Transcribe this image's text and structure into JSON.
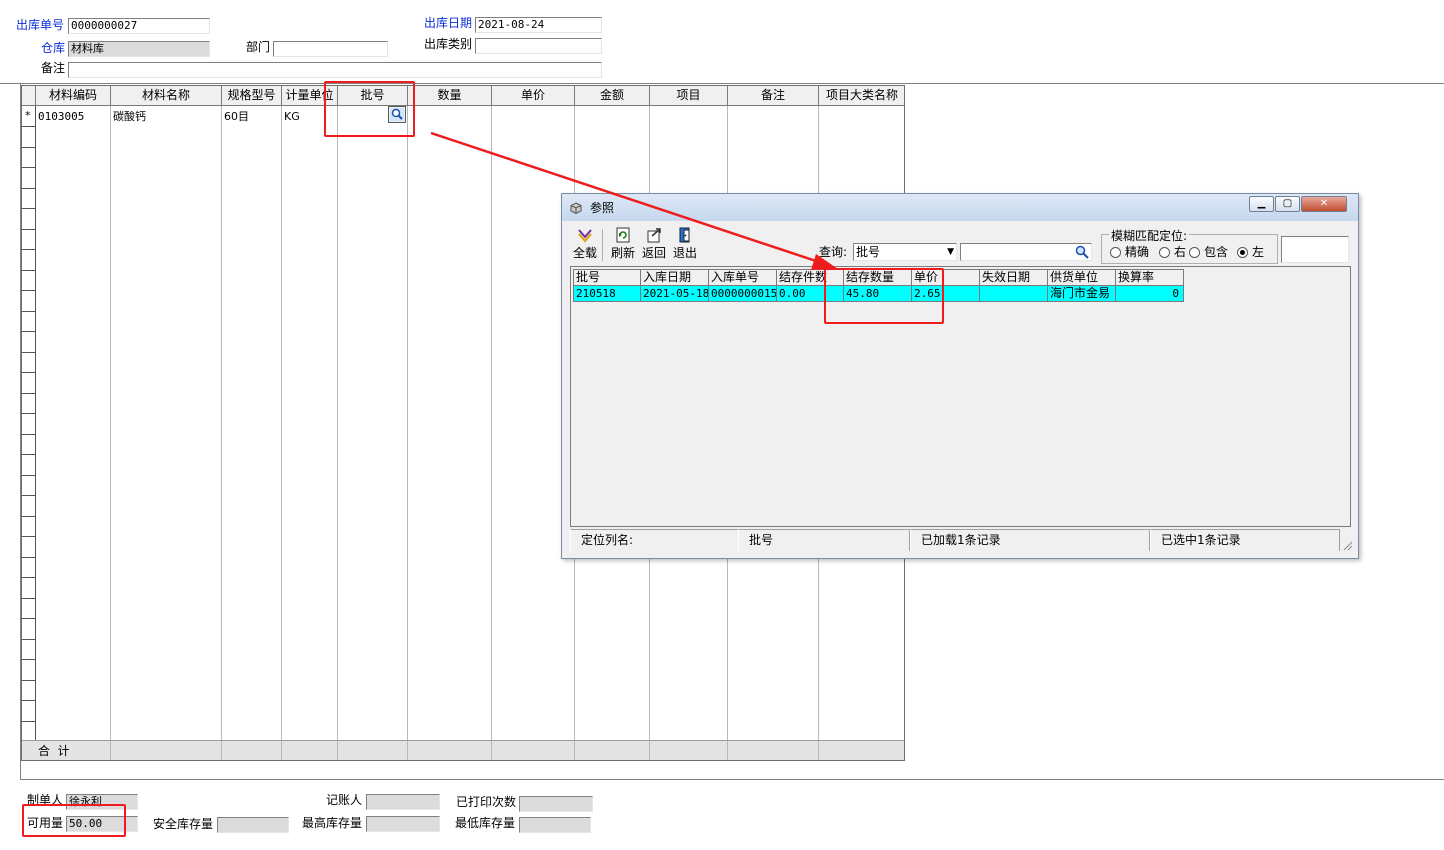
{
  "header": {
    "order_no_label": "出库单号",
    "order_no_value": "0000000027",
    "date_label": "出库日期",
    "date_value": "2021-08-24",
    "warehouse_label": "仓库",
    "warehouse_value": "材料库",
    "dept_label": "部门",
    "dept_value": "",
    "category_label": "出库类别",
    "category_value": "",
    "remark_label": "备注",
    "remark_value": ""
  },
  "grid": {
    "columns": [
      "材料编码",
      "材料名称",
      "规格型号",
      "计量单位",
      "批号",
      "数量",
      "单价",
      "金额",
      "项目",
      "备注",
      "项目大类名称"
    ],
    "row": {
      "marker": "*",
      "code": "0103005",
      "name": "碳酸钙",
      "spec": "60目",
      "unit": "KG",
      "batch": "",
      "qty": "",
      "price": "",
      "amount": "",
      "project": "",
      "remark": "",
      "project_class": ""
    },
    "total_label": "合  计"
  },
  "footer": {
    "maker_label": "制单人",
    "maker_value": "徐永利",
    "bookkeeper_label": "记账人",
    "bookkeeper_value": "",
    "print_count_label": "已打印次数",
    "print_count_value": "",
    "available_label": "可用量",
    "available_value": "50.00",
    "safety_stock_label": "安全库存量",
    "safety_stock_value": "",
    "max_stock_label": "最高库存量",
    "max_stock_value": "",
    "min_stock_label": "最低库存量",
    "min_stock_value": ""
  },
  "dialog": {
    "title": "参照",
    "toolbar": {
      "load_all": "全载",
      "refresh": "刷新",
      "back": "返回",
      "exit": "退出"
    },
    "query_label": "查询:",
    "query_field": "批号",
    "query_input": "",
    "fuzzy_label": "模糊匹配定位:",
    "fuzzy_options": [
      "精确",
      "右",
      "包含",
      "左"
    ],
    "fuzzy_selected": "左",
    "columns": [
      "批号",
      "入库日期",
      "入库单号",
      "结存件数",
      "结存数量",
      "单价",
      "失效日期",
      "供货单位",
      "换算率"
    ],
    "row": {
      "batch": "210518",
      "in_date": "2021-05-18",
      "in_no": "0000000015",
      "pieces": "0.00",
      "qty": "45.80",
      "price": "2.65",
      "expiry": "",
      "supplier": "海门市金易",
      "rate": "0"
    },
    "status": {
      "locate_label": "定位列名:",
      "locate_column": "批号",
      "loaded": "已加载1条记录",
      "selected": "已选中1条记录"
    }
  },
  "colors": {
    "label_blue": "#0b2fd6",
    "selected_row": "#00ffff",
    "highlight_red": "#ee1c1c",
    "readonly_gray": "#dcdcdc"
  }
}
